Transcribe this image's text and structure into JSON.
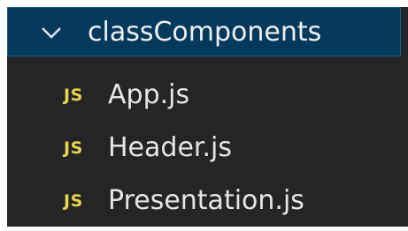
{
  "explorer": {
    "folder": {
      "label": "classComponents",
      "expanded": true,
      "icon": "chevron-down-icon",
      "selected": true
    },
    "files": [
      {
        "badge": "JS",
        "label": "App.js",
        "icon": "javascript-file-icon"
      },
      {
        "badge": "JS",
        "label": "Header.js",
        "icon": "javascript-file-icon"
      },
      {
        "badge": "JS",
        "label": "Presentation.js",
        "icon": "javascript-file-icon"
      }
    ]
  },
  "colors": {
    "background": "#252526",
    "selection": "#04395e",
    "selection_border": "#1e5f8e",
    "js_badge": "#e8d44d",
    "text": "#e6e6e6"
  }
}
